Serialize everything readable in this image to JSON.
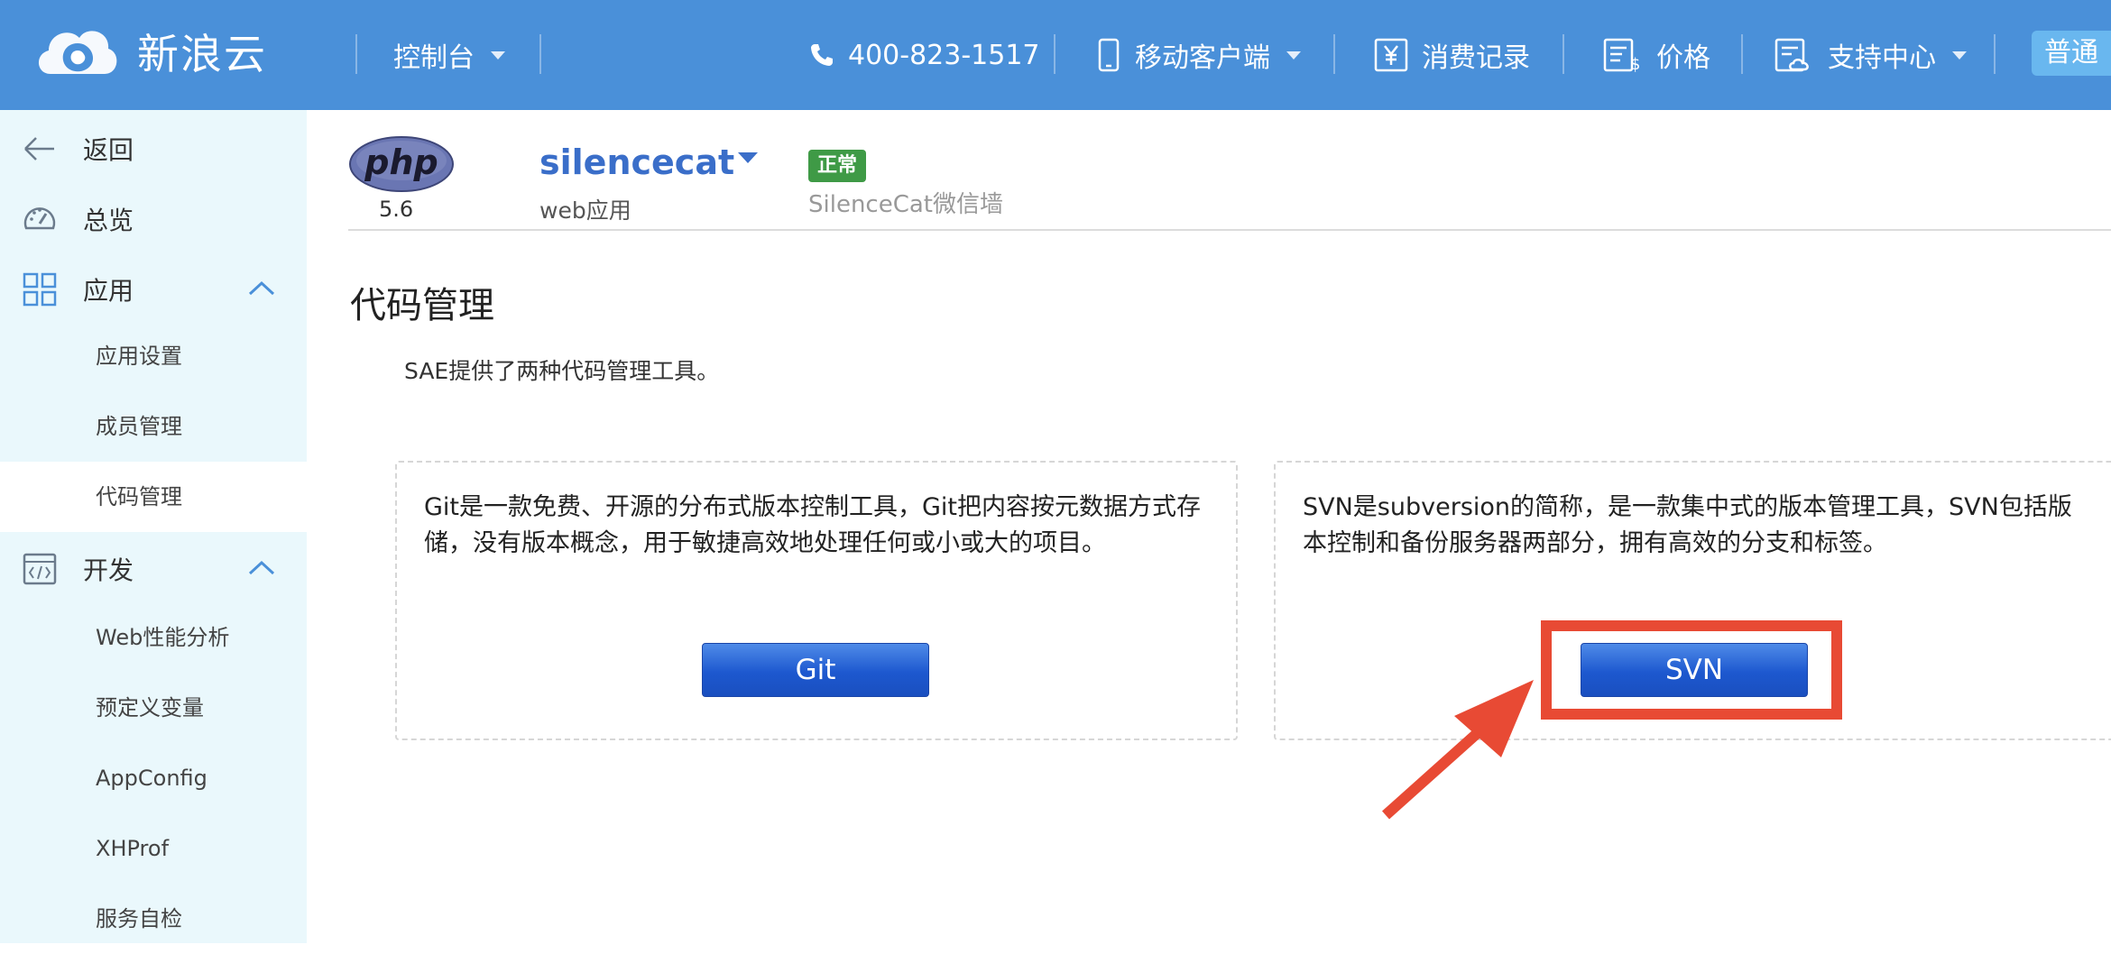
{
  "header": {
    "brand": "新浪云",
    "console_label": "控制台",
    "phone": "400-823-1517",
    "mobile_label": "移动客户端",
    "billing_label": "消费记录",
    "price_label": "价格",
    "support_label": "支持中心",
    "tier_badge": "普通",
    "accent_color": "#4a90d9"
  },
  "sidebar": {
    "back_label": "返回",
    "overview_label": "总览",
    "app_label": "应用",
    "app_items": [
      "应用设置",
      "成员管理",
      "代码管理"
    ],
    "active_item": "代码管理",
    "dev_label": "开发",
    "dev_items": [
      "Web性能分析",
      "预定义变量",
      "AppConfig",
      "XHProf",
      "服务自检"
    ],
    "background_color": "#eaf8fc"
  },
  "app": {
    "php_logo_text": "php",
    "php_version": "5.6",
    "name": "silencecat",
    "type": "web应用",
    "status": "正常",
    "status_color": "#3f9a46",
    "description": "SilenceCat微信墙"
  },
  "main": {
    "title": "代码管理",
    "intro": "SAE提供了两种代码管理工具。",
    "git": {
      "description": "Git是一款免费、开源的分布式版本控制工具，Git把内容按元数据方式存储，没有版本概念，用于敏捷高效地处理任何或小或大的项目。",
      "button_label": "Git"
    },
    "svn": {
      "description": "SVN是subversion的简称，是一款集中式的版本管理工具，SVN包括版本控制和备份服务器两部分，拥有高效的分支和标签。",
      "button_label": "SVN"
    }
  },
  "annotation": {
    "highlight_color": "#e84a34"
  }
}
